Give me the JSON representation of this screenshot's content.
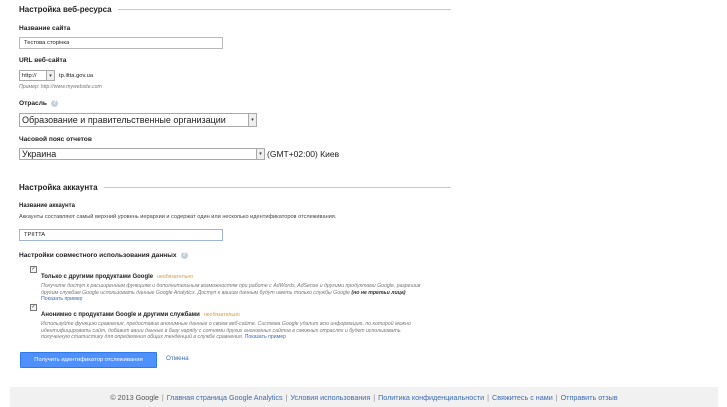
{
  "website_section": {
    "heading": "Настройка веб-ресурса",
    "site_name": {
      "label": "Название сайта",
      "value": "Тестова сторінка"
    },
    "site_url": {
      "label": "URL веб-сайта",
      "protocol": "http://",
      "value": "tp.iltta.gov.ua",
      "example": "Пример: http://www.mywebsite.com"
    },
    "industry": {
      "label": "Отрасль",
      "value": "Образование и правительственные организации"
    },
    "timezone": {
      "label": "Часовой пояс отчетов",
      "country": "Украина",
      "zone": "(GMT+02:00) Киев"
    }
  },
  "account_section": {
    "heading": "Настройка аккаунта",
    "account_name": {
      "label": "Название аккаунта",
      "description": "Аккаунты составляют самый верхний уровень иерархии и содержат один или несколько идентификаторов отслеживания.",
      "value": "TPIITTA"
    }
  },
  "data_sharing": {
    "heading": "Настройки совместного использования данных",
    "options": [
      {
        "checked": true,
        "title": "Только с другими продуктами Google",
        "tag": "необязательно",
        "text": "Получите доступ к расширенным функциям и дополнительным возможностям при работе с AdWords, AdSense и другими продуктами Google, разрешив другим службам Google использовать данные Google Analytics. Доступ к вашим данным будут иметь только службы Google",
        "text_tail": "(но не третьи лица)",
        "link": "Показать пример"
      },
      {
        "checked": true,
        "title": "Анонимно с продуктами Google и другими службами",
        "tag": "необязательно",
        "text": "Используйте функцию сравнения, предоставив анонимные данные о своем веб-сайте. Система Google удалит всю информацию, по которой можно идентифицировать сайт, добавит ваши данные в базу наряду с сотнями других анонимных сайтов в смежных отраслях и будет использовать полученную статистику для определения общих тенденций в службе сравнения.",
        "link": "Показать пример"
      }
    ]
  },
  "actions": {
    "primary": "Получить идентификатор отслеживания",
    "cancel": "Отмена"
  },
  "footer": {
    "copyright": "© 2013 Google",
    "links": [
      "Главная страница Google Analytics",
      "Условия использования",
      "Политика конфиденциальности",
      "Свяжитесь с нами",
      "Отправить отзыв"
    ]
  }
}
